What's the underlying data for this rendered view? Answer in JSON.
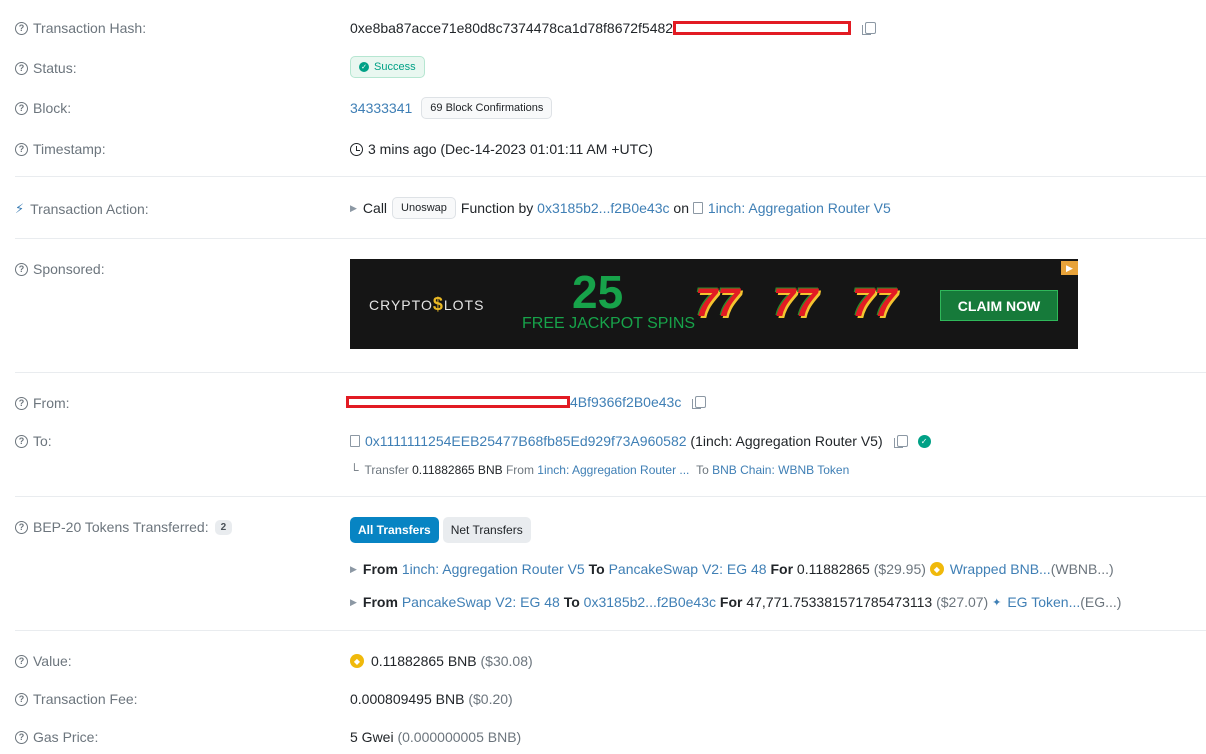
{
  "labels": {
    "hash": "Transaction Hash:",
    "status": "Status:",
    "block": "Block:",
    "timestamp": "Timestamp:",
    "action": "Transaction Action:",
    "sponsored": "Sponsored:",
    "from": "From:",
    "to": "To:",
    "tokens": "BEP-20 Tokens Transferred:",
    "value": "Value:",
    "fee": "Transaction Fee:",
    "gas": "Gas Price:"
  },
  "tx": {
    "hash": "0xe8ba87acce71e80d8c7374478ca1d78f8672f5482",
    "status": "Success",
    "block": "34333341",
    "confirmations": "69 Block Confirmations",
    "timestamp": "3 mins ago (Dec-14-2023 01:01:11 AM +UTC)"
  },
  "action": {
    "call": "Call",
    "method": "Unoswap",
    "function_by": "Function by",
    "caller": "0x3185b2...f2B0e43c",
    "on": "on",
    "contract": "1inch: Aggregation Router V5"
  },
  "ad": {
    "logo_a": "CRYPTO",
    "logo_b": "$",
    "logo_c": "LOTS",
    "number": "25",
    "spins": "FREE JACKPOT SPINS",
    "seven": "7",
    "cta": "CLAIM NOW"
  },
  "from": {
    "suffix": "4Bf9366f2B0e43c"
  },
  "to": {
    "address": "0x1111111254EEB25477B68fb85Ed929f73A960582",
    "name": "(1inch: Aggregation Router V5)",
    "transfer_word": "Transfer",
    "transfer_amount": "0.11882865 BNB",
    "from_word": "From",
    "transfer_from": "1inch: Aggregation Router ...",
    "to_word": "To",
    "transfer_to": "BNB Chain: WBNB Token"
  },
  "tokens": {
    "count": "2",
    "tab_all": "All Transfers",
    "tab_net": "Net Transfers",
    "items": [
      {
        "from_word": "From",
        "from": "1inch: Aggregation Router V5",
        "to_word": "To",
        "to": "PancakeSwap V2: EG 48",
        "for_word": "For",
        "amount": "0.11882865",
        "usd": "($29.95)",
        "token": "Wrapped BNB...",
        "symbol": "(WBNB...)"
      },
      {
        "from_word": "From",
        "from": "PancakeSwap V2: EG 48",
        "to_word": "To",
        "to": "0x3185b2...f2B0e43c",
        "for_word": "For",
        "amount": "47,771.753381571785473113",
        "usd": "($27.07)",
        "token": "EG Token...",
        "symbol": "(EG...)"
      }
    ]
  },
  "value": {
    "amount": "0.11882865 BNB",
    "usd": "($30.08)"
  },
  "fee": {
    "amount": "0.000809495 BNB",
    "usd": "($0.20)"
  },
  "gas": {
    "amount": "5 Gwei",
    "bnb": "(0.000000005 BNB)"
  }
}
